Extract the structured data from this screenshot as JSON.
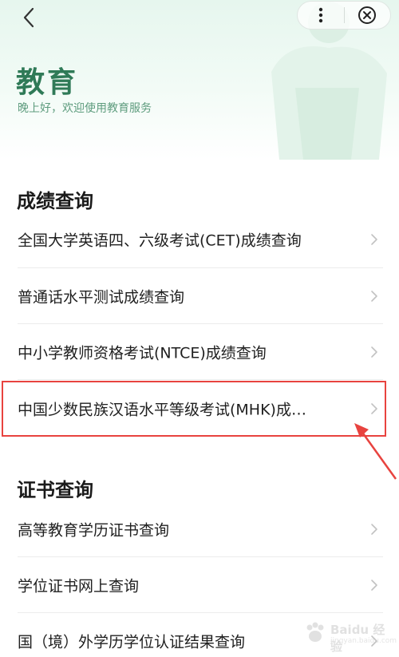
{
  "header": {
    "title": "教育",
    "greeting": "晚上好，欢迎使用教育服务"
  },
  "nav": {
    "back_icon": "chevron-left-icon",
    "more_icon": "more-vertical-icon",
    "close_icon": "close-circle-icon"
  },
  "sections": [
    {
      "title": "成绩查询",
      "items": [
        {
          "label": "全国大学英语四、六级考试(CET)成绩查询"
        },
        {
          "label": "普通话水平测试成绩查询"
        },
        {
          "label": "中小学教师资格考试(NTCE)成绩查询"
        },
        {
          "label": "中国少数民族汉语水平等级考试(MHK)成…"
        }
      ]
    },
    {
      "title": "证书查询",
      "items": [
        {
          "label": "高等教育学历证书查询"
        },
        {
          "label": "学位证书网上查询"
        },
        {
          "label": "国（境）外学历学位认证结果查询"
        }
      ]
    }
  ],
  "watermark": {
    "brand": "Baidu 经验",
    "url": "jingyan.baidu.com"
  },
  "colors": {
    "title_green": "#2f7a57",
    "highlight_red": "#e8433f"
  }
}
